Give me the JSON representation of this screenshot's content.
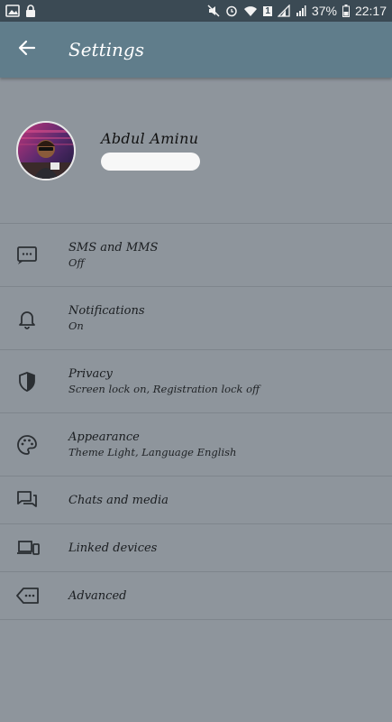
{
  "status_bar": {
    "battery_percent": "37%",
    "time": "22:17",
    "sim_badge": "1"
  },
  "app_bar": {
    "title": "Settings",
    "back_icon": "arrow-back-icon"
  },
  "profile": {
    "name": "Abdul Aminu"
  },
  "settings": [
    {
      "title": "SMS and MMS",
      "subtitle": "Off",
      "icon": "message-icon"
    },
    {
      "title": "Notifications",
      "subtitle": "On",
      "icon": "bell-icon"
    },
    {
      "title": "Privacy",
      "subtitle": "Screen lock on, Registration lock off",
      "icon": "shield-icon"
    },
    {
      "title": "Appearance",
      "subtitle": "Theme Light, Language English",
      "icon": "palette-icon"
    },
    {
      "title": "Chats and media",
      "subtitle": "",
      "icon": "chat-icon"
    },
    {
      "title": "Linked devices",
      "subtitle": "",
      "icon": "devices-icon"
    },
    {
      "title": "Advanced",
      "subtitle": "",
      "icon": "tag-more-icon"
    }
  ],
  "colors": {
    "app_bar": "#607d8b",
    "status_bar": "#3b4a54",
    "background": "#8e959c"
  }
}
